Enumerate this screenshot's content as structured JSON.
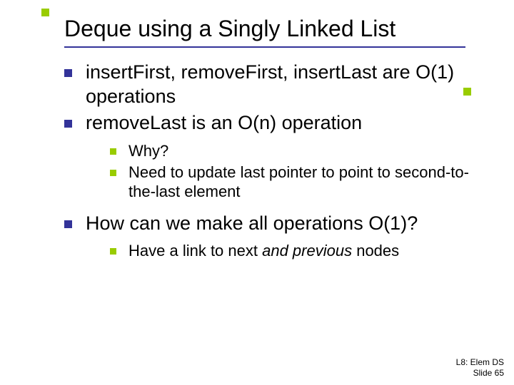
{
  "title": "Deque using a Singly Linked List",
  "bullets": {
    "b1": "insertFirst, removeFirst, insertLast are O(1) operations",
    "b2": "removeLast is an O(n) operation",
    "b2_sub": {
      "s1": "Why?",
      "s2": "Need to update last pointer to point to second-to-the-last element"
    },
    "b3": "How can we make all operations O(1)?",
    "b3_sub": {
      "s1_pre": "Have a link to next ",
      "s1_em": "and previous",
      "s1_post": " nodes"
    }
  },
  "footer": {
    "line1": "L8: Elem DS",
    "line2": "Slide 65"
  }
}
